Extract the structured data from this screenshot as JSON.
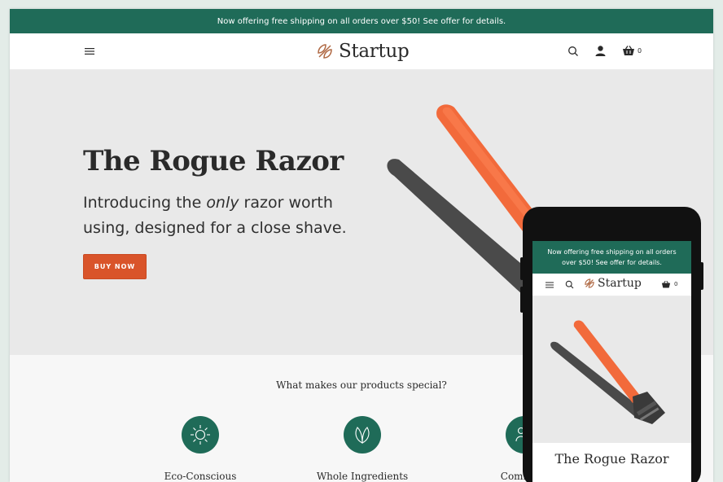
{
  "announcement": "Now offering free shipping on all orders over $50! See offer for details.",
  "header": {
    "logo_text": "Startup",
    "cart_count": "0"
  },
  "hero": {
    "title": "The Rogue Razor",
    "subtitle_before": "Introducing the ",
    "subtitle_emphasis": "only",
    "subtitle_after": " razor worth using, designed for a close shave.",
    "cta_label": "BUY NOW"
  },
  "features": {
    "heading": "What makes our products special?",
    "items": [
      {
        "label": "Eco-Conscious",
        "icon": "sun-icon"
      },
      {
        "label": "Whole Ingredients",
        "icon": "leaf-icon"
      },
      {
        "label": "Communi",
        "icon": "community-icon"
      }
    ]
  },
  "mobile": {
    "announcement": "Now offering free shipping on all orders over $50! See offer for details.",
    "logo_text": "Startup",
    "cart_count": "0",
    "hero_title": "The Rogue Razor"
  },
  "colors": {
    "brand_green": "#1f6b58",
    "accent_orange": "#d9542a",
    "razor_orange": "#f26a3b",
    "hero_bg": "#e9e9e9"
  }
}
